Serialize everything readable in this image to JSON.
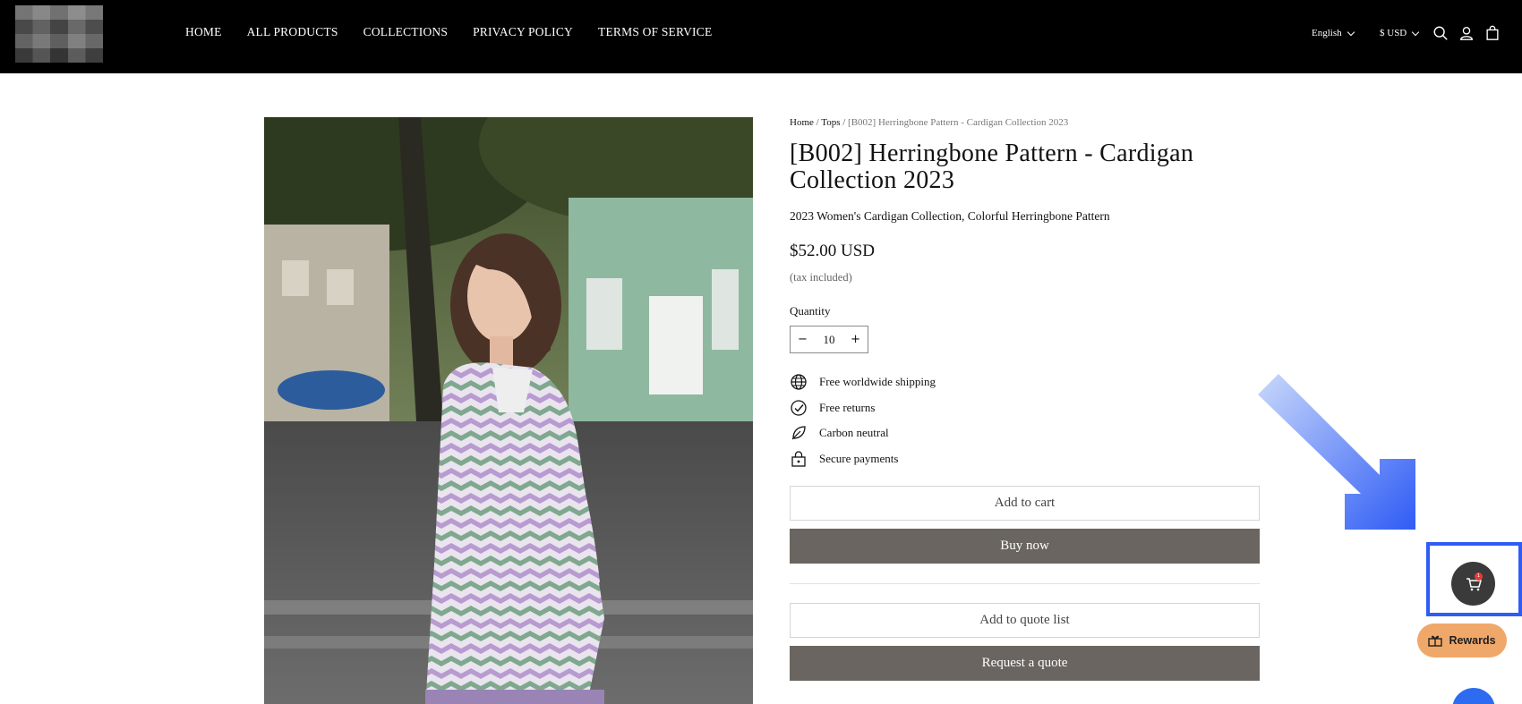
{
  "header": {
    "logo_alt": "Store logo (pixelated)",
    "nav": [
      "HOME",
      "ALL PRODUCTS",
      "COLLECTIONS",
      "PRIVACY POLICY",
      "TERMS OF SERVICE"
    ],
    "language": "English",
    "currency": "$ USD",
    "icons": [
      "search-icon",
      "account-icon",
      "bag-icon"
    ]
  },
  "breadcrumb": {
    "home": "Home",
    "sep1": " / ",
    "category": "Tops",
    "sep2": " / ",
    "current": "[B002] Herringbone Pattern - Cardigan Collection 2023"
  },
  "product": {
    "title": "[B002] Herringbone Pattern - Cardigan Collection 2023",
    "subtitle": "2023 Women's Cardigan Collection, Colorful Herringbone Pattern",
    "price": "$52.00 USD",
    "tax_note": "(tax included)",
    "quantity_label": "Quantity",
    "quantity_minus": "−",
    "quantity_value": "10",
    "quantity_plus": "+",
    "features": [
      {
        "icon": "globe-icon",
        "label": "Free worldwide shipping"
      },
      {
        "icon": "check-circle-icon",
        "label": "Free returns"
      },
      {
        "icon": "leaf-icon",
        "label": "Carbon neutral"
      },
      {
        "icon": "lock-icon",
        "label": "Secure payments"
      }
    ]
  },
  "actions": {
    "add_to_cart": "Add to cart",
    "buy_now": "Buy now",
    "add_to_quote": "Add to quote list",
    "request_quote": "Request a quote"
  },
  "widgets": {
    "cart_badge": "1",
    "rewards": "Rewards"
  },
  "colors": {
    "header_bg": "#000000",
    "button_solid": "#6a6560",
    "highlight": "#2f5cf5",
    "rewards_bg": "#f0a86a",
    "chat_bg": "#2d6cf0"
  }
}
